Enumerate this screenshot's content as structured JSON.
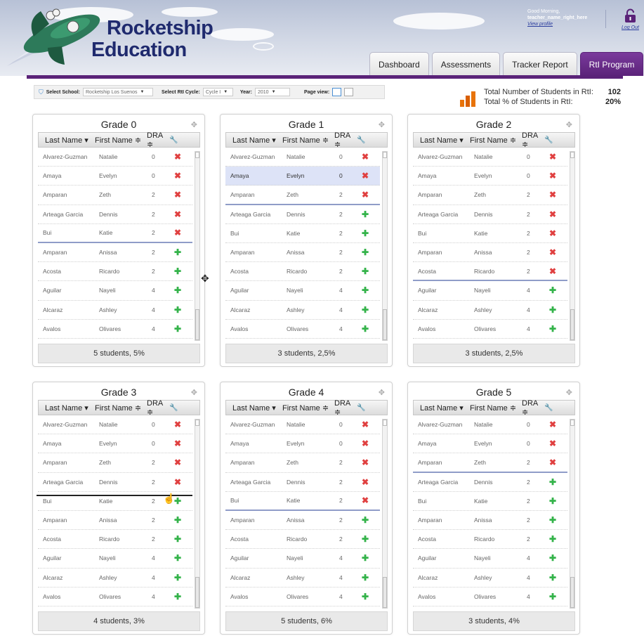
{
  "header": {
    "brand_line1": "Rocketship",
    "brand_line2": "Education",
    "greeting": "Good Morning,",
    "username": "teacher_name_right_here",
    "view_profile": "View profile",
    "logout": "Log Out",
    "tabs": [
      {
        "label": "Dashboard"
      },
      {
        "label": "Assessments"
      },
      {
        "label": "Tracker Report"
      },
      {
        "label": "RtI Program"
      }
    ],
    "active_tab": "RtI Program",
    "accent_color": "#5a2278"
  },
  "filters": {
    "school_label": "Select School:",
    "school_value": "Rocketship Los Suenos",
    "cycle_label": "Select RtI Cycle:",
    "cycle_value": "Cycle I",
    "year_label": "Year:",
    "year_value": "2010",
    "page_view_label": "Page view:"
  },
  "stats": {
    "total_students_label": "Total Number of Students in RtI:",
    "total_students_value": "102",
    "total_percent_label": "Total % of Students in RtI:",
    "total_percent_value": "20%"
  },
  "columns": {
    "last": "Last Name ▾",
    "first": "First Name ≑",
    "dra": "DRA ≑"
  },
  "grades": [
    {
      "title": "Grade 0",
      "footer": "5 students, 5%",
      "rows": [
        {
          "last": "Alvarez-Guzman",
          "first": "Natalie",
          "dra": "0",
          "action": "✖"
        },
        {
          "last": "Amaya",
          "first": "Evelyn",
          "dra": "0",
          "action": "✖"
        },
        {
          "last": "Amparan",
          "first": "Zeth",
          "dra": "2",
          "action": "✖"
        },
        {
          "last": "Arteaga Garcia",
          "first": "Dennis",
          "dra": "2",
          "action": "✖"
        },
        {
          "last": "Bui",
          "first": "Katie",
          "dra": "2",
          "action": "✖"
        },
        {
          "last": "Amparan",
          "first": "Anissa",
          "dra": "2",
          "action": "✚"
        },
        {
          "last": "Acosta",
          "first": "Ricardo",
          "dra": "2",
          "action": "✚"
        },
        {
          "last": "Aguilar",
          "first": "Nayeli",
          "dra": "4",
          "action": "✚"
        },
        {
          "last": "Alcaraz",
          "first": "Ashley",
          "dra": "4",
          "action": "✚"
        },
        {
          "last": "Avalos",
          "first": "Olivares",
          "dra": "4",
          "action": "✚"
        }
      ]
    },
    {
      "title": "Grade 1",
      "footer": "3 students, 2,5%",
      "rows": [
        {
          "last": "Alvarez-Guzman",
          "first": "Natalie",
          "dra": "0",
          "action": "✖"
        },
        {
          "last": "Amaya",
          "first": "Evelyn",
          "dra": "0",
          "action": "✖"
        },
        {
          "last": "Amparan",
          "first": "Zeth",
          "dra": "2",
          "action": "✖"
        },
        {
          "last": "Arteaga Garcia",
          "first": "Dennis",
          "dra": "2",
          "action": "✚"
        },
        {
          "last": "Bui",
          "first": "Katie",
          "dra": "2",
          "action": "✚"
        },
        {
          "last": "Amparan",
          "first": "Anissa",
          "dra": "2",
          "action": "✚"
        },
        {
          "last": "Acosta",
          "first": "Ricardo",
          "dra": "2",
          "action": "✚"
        },
        {
          "last": "Aguilar",
          "first": "Nayeli",
          "dra": "4",
          "action": "✚"
        },
        {
          "last": "Alcaraz",
          "first": "Ashley",
          "dra": "4",
          "action": "✚"
        },
        {
          "last": "Avalos",
          "first": "Olivares",
          "dra": "4",
          "action": "✚"
        }
      ]
    },
    {
      "title": "Grade 2",
      "footer": "3 students, 2,5%",
      "rows": [
        {
          "last": "Alvarez-Guzman",
          "first": "Natalie",
          "dra": "0",
          "action": "✖"
        },
        {
          "last": "Amaya",
          "first": "Evelyn",
          "dra": "0",
          "action": "✖"
        },
        {
          "last": "Amparan",
          "first": "Zeth",
          "dra": "2",
          "action": "✖"
        },
        {
          "last": "Arteaga Garcia",
          "first": "Dennis",
          "dra": "2",
          "action": "✖"
        },
        {
          "last": "Bui",
          "first": "Katie",
          "dra": "2",
          "action": "✖"
        },
        {
          "last": "Amparan",
          "first": "Anissa",
          "dra": "2",
          "action": "✖"
        },
        {
          "last": "Acosta",
          "first": "Ricardo",
          "dra": "2",
          "action": "✖"
        },
        {
          "last": "Aguilar",
          "first": "Nayeli",
          "dra": "4",
          "action": "✚"
        },
        {
          "last": "Alcaraz",
          "first": "Ashley",
          "dra": "4",
          "action": "✚"
        },
        {
          "last": "Avalos",
          "first": "Olivares",
          "dra": "4",
          "action": "✚"
        }
      ]
    },
    {
      "title": "Grade 3",
      "footer": "4 students, 3%",
      "rows": [
        {
          "last": "Alvarez-Guzman",
          "first": "Natalie",
          "dra": "0",
          "action": "✖"
        },
        {
          "last": "Amaya",
          "first": "Evelyn",
          "dra": "0",
          "action": "✖"
        },
        {
          "last": "Amparan",
          "first": "Zeth",
          "dra": "2",
          "action": "✖"
        },
        {
          "last": "Arteaga Garcia",
          "first": "Dennis",
          "dra": "2",
          "action": "✖"
        },
        {
          "last": "Bui",
          "first": "Katie",
          "dra": "2",
          "action": "✚"
        },
        {
          "last": "Amparan",
          "first": "Anissa",
          "dra": "2",
          "action": "✚"
        },
        {
          "last": "Acosta",
          "first": "Ricardo",
          "dra": "2",
          "action": "✚"
        },
        {
          "last": "Aguilar",
          "first": "Nayeli",
          "dra": "4",
          "action": "✚"
        },
        {
          "last": "Alcaraz",
          "first": "Ashley",
          "dra": "4",
          "action": "✚"
        },
        {
          "last": "Avalos",
          "first": "Olivares",
          "dra": "4",
          "action": "✚"
        }
      ]
    },
    {
      "title": "Grade 4",
      "footer": "5 students, 6%",
      "rows": [
        {
          "last": "Alvarez-Guzman",
          "first": "Natalie",
          "dra": "0",
          "action": "✖"
        },
        {
          "last": "Amaya",
          "first": "Evelyn",
          "dra": "0",
          "action": "✖"
        },
        {
          "last": "Amparan",
          "first": "Zeth",
          "dra": "2",
          "action": "✖"
        },
        {
          "last": "Arteaga Garcia",
          "first": "Dennis",
          "dra": "2",
          "action": "✖"
        },
        {
          "last": "Bui",
          "first": "Katie",
          "dra": "2",
          "action": "✖"
        },
        {
          "last": "Amparan",
          "first": "Anissa",
          "dra": "2",
          "action": "✚"
        },
        {
          "last": "Acosta",
          "first": "Ricardo",
          "dra": "2",
          "action": "✚"
        },
        {
          "last": "Aguilar",
          "first": "Nayeli",
          "dra": "4",
          "action": "✚"
        },
        {
          "last": "Alcaraz",
          "first": "Ashley",
          "dra": "4",
          "action": "✚"
        },
        {
          "last": "Avalos",
          "first": "Olivares",
          "dra": "4",
          "action": "✚"
        }
      ]
    },
    {
      "title": "Grade 5",
      "footer": "3 students, 4%",
      "rows": [
        {
          "last": "Alvarez-Guzman",
          "first": "Natalie",
          "dra": "0",
          "action": "✖"
        },
        {
          "last": "Amaya",
          "first": "Evelyn",
          "dra": "0",
          "action": "✖"
        },
        {
          "last": "Amparan",
          "first": "Zeth",
          "dra": "2",
          "action": "✖"
        },
        {
          "last": "Arteaga Garcia",
          "first": "Dennis",
          "dra": "2",
          "action": "✚"
        },
        {
          "last": "Bui",
          "first": "Katie",
          "dra": "2",
          "action": "✚"
        },
        {
          "last": "Amparan",
          "first": "Anissa",
          "dra": "2",
          "action": "✚"
        },
        {
          "last": "Acosta",
          "first": "Ricardo",
          "dra": "2",
          "action": "✚"
        },
        {
          "last": "Aguilar",
          "first": "Nayeli",
          "dra": "4",
          "action": "✚"
        },
        {
          "last": "Alcaraz",
          "first": "Ashley",
          "dra": "4",
          "action": "✚"
        },
        {
          "last": "Avalos",
          "first": "Olivares",
          "dra": "4",
          "action": "✚"
        }
      ]
    }
  ]
}
